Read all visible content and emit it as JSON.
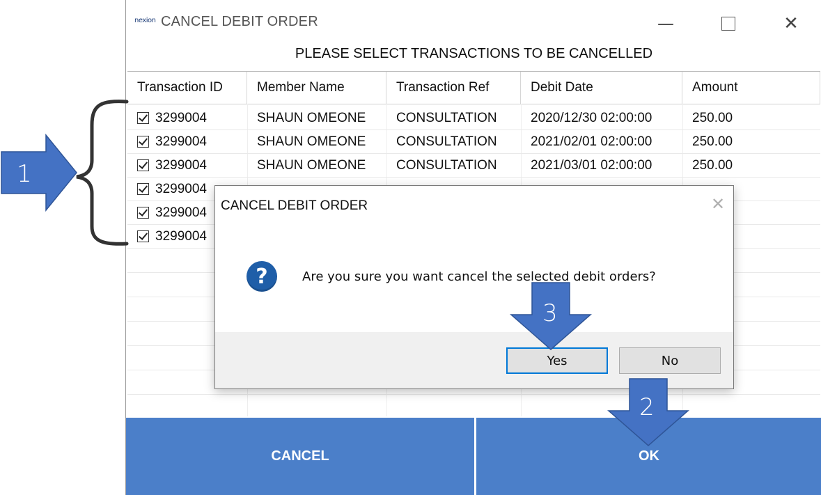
{
  "window": {
    "icon_text": "nexion",
    "title": "CANCEL DEBIT ORDER",
    "instruction": "PLEASE SELECT TRANSACTIONS TO BE CANCELLED"
  },
  "grid": {
    "columns": [
      "Transaction ID",
      "Member Name",
      "Transaction Ref",
      "Debit Date",
      "Amount"
    ],
    "rows": [
      {
        "checked": true,
        "id": "3299004",
        "member": "SHAUN OMEONE",
        "ref": "CONSULTATION",
        "date": "2020/12/30 02:00:00",
        "amount": "250.00"
      },
      {
        "checked": true,
        "id": "3299004",
        "member": "SHAUN OMEONE",
        "ref": "CONSULTATION",
        "date": "2021/02/01 02:00:00",
        "amount": "250.00"
      },
      {
        "checked": true,
        "id": "3299004",
        "member": "SHAUN OMEONE",
        "ref": "CONSULTATION",
        "date": "2021/03/01 02:00:00",
        "amount": "250.00"
      },
      {
        "checked": true,
        "id": "3299004",
        "member": "",
        "ref": "",
        "date": "",
        "amount": ""
      },
      {
        "checked": true,
        "id": "3299004",
        "member": "",
        "ref": "",
        "date": "",
        "amount": ""
      },
      {
        "checked": true,
        "id": "3299004",
        "member": "",
        "ref": "",
        "date": "",
        "amount": ""
      }
    ]
  },
  "buttons": {
    "cancel_label": "CANCEL",
    "ok_label": "OK"
  },
  "dialog": {
    "title": "CANCEL DEBIT ORDER",
    "message": "Are you sure you want cancel the selected debit orders?",
    "icon_glyph": "?",
    "yes_label": "Yes",
    "no_label": "No"
  },
  "annotations": {
    "step1": "1",
    "step2": "2",
    "step3": "3",
    "color": "#4472c4"
  },
  "colors": {
    "button_blue": "#4b7fc9",
    "focus_blue": "#0078d7"
  }
}
